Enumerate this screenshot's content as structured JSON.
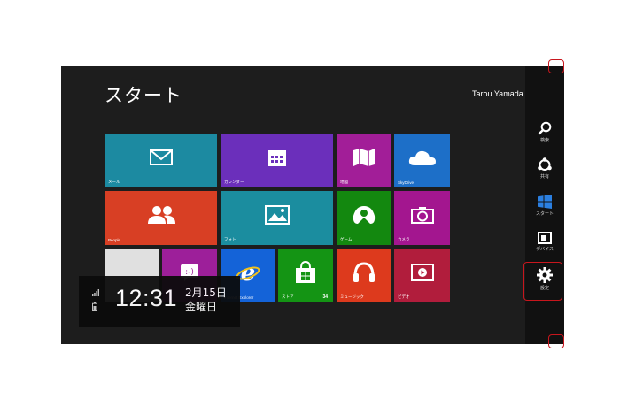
{
  "start": {
    "title": "スタート",
    "user": "Tarou Yamada"
  },
  "tiles": {
    "mail": {
      "label": "メール",
      "color": "#1c8aa1"
    },
    "calendar": {
      "label": "カレンダー",
      "color": "#6b2fbb"
    },
    "photo_places": {
      "label": "地図",
      "color": "#a21e98"
    },
    "skydrive": {
      "label": "SkyDrive",
      "color": "#1d6fc8"
    },
    "people": {
      "label": "People",
      "color": "#d83f24"
    },
    "photos": {
      "label": "フォト",
      "color": "#1b8d9f"
    },
    "games": {
      "label": "ゲーム",
      "color": "#13880f"
    },
    "camera": {
      "label": "カメラ",
      "color": "#a3168f"
    },
    "desktop": {
      "label": "",
      "color": "#e0e0e0"
    },
    "messaging": {
      "label": "",
      "color": "#9d1f9a"
    },
    "ie": {
      "label": "Internet Explorer",
      "color": "#1463d8"
    },
    "store": {
      "label": "ストア",
      "color": "#149414",
      "count": "34"
    },
    "music": {
      "label": "ミュージック",
      "color": "#dd3a1d"
    },
    "video": {
      "label": "ビデオ",
      "color": "#b11d3c"
    }
  },
  "lockinfo": {
    "time": "12:31",
    "date": "2月15日",
    "weekday": "金曜日"
  },
  "charms": {
    "search": "検索",
    "share": "共有",
    "start": "スタート",
    "devices": "デバイス",
    "settings": "設定"
  },
  "colors": {
    "highlight": "#c8161d",
    "background": "#1d1d1d",
    "charm_bar": "#111111"
  },
  "icons": [
    "search-icon",
    "share-icon",
    "windows-logo-icon",
    "devices-icon",
    "gear-icon",
    "mail-icon",
    "calendar-icon",
    "map-icon",
    "cloud-icon",
    "people-icon",
    "photo-icon",
    "gamepad-icon",
    "camera-icon",
    "smiley-icon",
    "ie-icon",
    "store-bag-icon",
    "headphones-icon",
    "play-icon",
    "signal-icon",
    "battery-icon"
  ]
}
